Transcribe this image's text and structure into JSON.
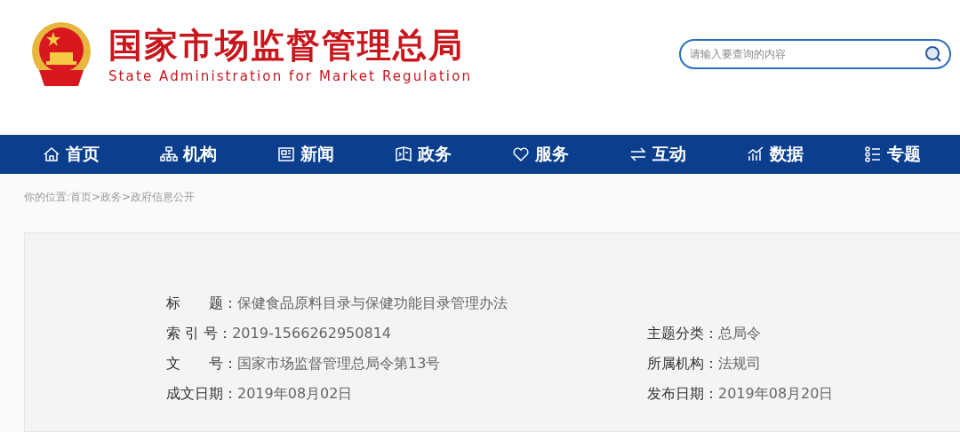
{
  "header": {
    "title": "国家市场监督管理总局",
    "subtitle": "State Administration for Market Regulation",
    "search": {
      "placeholder": "请输入要查询的内容"
    }
  },
  "nav": [
    {
      "label": "首页"
    },
    {
      "label": "机构"
    },
    {
      "label": "新闻"
    },
    {
      "label": "政务"
    },
    {
      "label": "服务"
    },
    {
      "label": "互动"
    },
    {
      "label": "数据"
    },
    {
      "label": "专题"
    }
  ],
  "breadcrumb": "你的位置:首页>政务>政府信息公开",
  "info": {
    "rows": [
      [
        {
          "label": "标　　题：",
          "value": "保健食品原料目录与保健功能目录管理办法"
        }
      ],
      [
        {
          "label": "索 引 号：",
          "value": "2019-1566262950814"
        },
        {
          "label": "主题分类：",
          "value": "总局令"
        }
      ],
      [
        {
          "label": "文　　号：",
          "value": "国家市场监督管理总局令第13号"
        },
        {
          "label": "所属机构：",
          "value": "法规司"
        }
      ],
      [
        {
          "label": "成文日期：",
          "value": "2019年08月02日"
        },
        {
          "label": "发布日期：",
          "value": "2019年08月20日"
        }
      ]
    ]
  }
}
